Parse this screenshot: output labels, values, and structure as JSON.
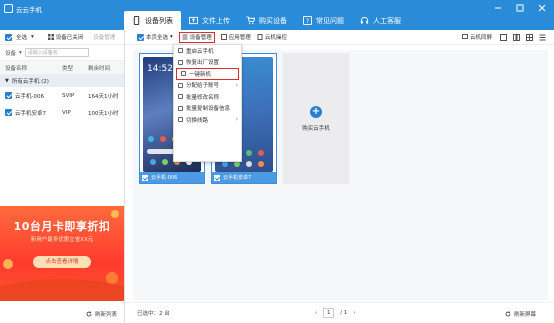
{
  "app": {
    "title": "云云手机"
  },
  "tabs": [
    {
      "label": "设备列表",
      "icon": "phone-icon"
    },
    {
      "label": "文件上传",
      "icon": "upload-icon"
    },
    {
      "label": "购买设备",
      "icon": "cart-icon"
    },
    {
      "label": "常见问题",
      "icon": "question-icon"
    },
    {
      "label": "人工客服",
      "icon": "headset-icon"
    }
  ],
  "sidebar": {
    "select_all": "全选",
    "selected_arrow": "▾",
    "set_closed": "设备已关闭",
    "set_group": "设备管理",
    "search_label": "设备",
    "search_placeholder": "请输入设备名",
    "columns": [
      "设备名称",
      "类型",
      "剩余时间"
    ],
    "group": "所有云手机 (2)",
    "rows": [
      {
        "name": "云手机-006",
        "type": "SVIP",
        "remaining": "164天1小时"
      },
      {
        "name": "云手机安卓7",
        "type": "VIP",
        "remaining": "100天1小时"
      }
    ],
    "promo": {
      "headline": "10台月卡即享折扣",
      "sub": "新用户最多优惠立省XX元",
      "cta": "点击查看详情"
    },
    "refresh": "刷新列表"
  },
  "toolbar": {
    "select_page": "本页全选",
    "device_manage": "设备管理",
    "app_manage": "应用管理",
    "cloud_control": "云机操控",
    "sync": "云机同屏",
    "view_label": "云机分屏"
  },
  "menu": [
    {
      "label": "重启云手机",
      "arrow": false
    },
    {
      "label": "恢复出厂设置",
      "arrow": false
    },
    {
      "label": "一键新机",
      "arrow": false,
      "highlight": true
    },
    {
      "label": "分配给子账号",
      "arrow": true
    },
    {
      "label": "批量修改名称",
      "arrow": false
    },
    {
      "label": "批量复制设备信息",
      "arrow": false
    },
    {
      "label": "切换线路",
      "arrow": true
    }
  ],
  "devices": [
    {
      "name": "云手机-006"
    },
    {
      "name": "云手机安卓7"
    }
  ],
  "buy_card": {
    "label": "购买云手机"
  },
  "status": {
    "selected": "已选中：2 台",
    "page_current": "1",
    "page_total": "/ 1",
    "refresh": "刷新屏幕"
  },
  "colors": {
    "titlebar": "#2a8bd8",
    "accent": "#2a7ed0",
    "highlight": "#d9302c"
  }
}
